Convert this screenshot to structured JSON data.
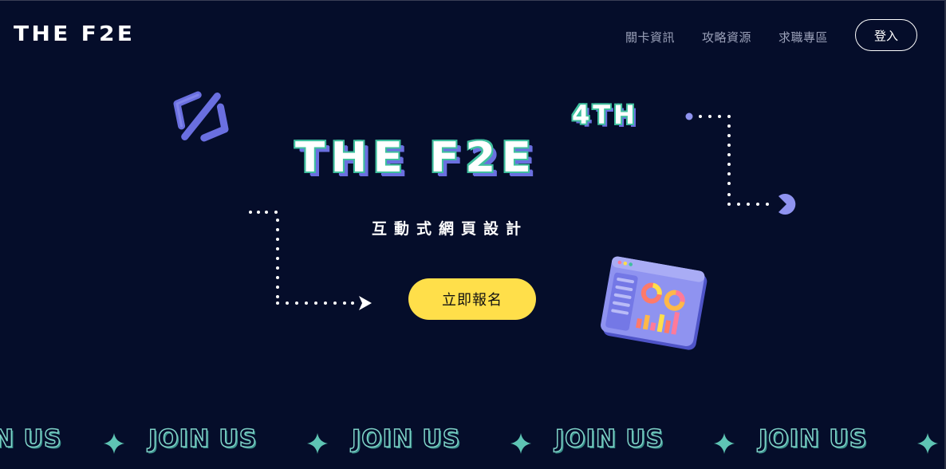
{
  "header": {
    "logo": "THE F2E",
    "nav": [
      "關卡資訊",
      "攻略資源",
      "求職專區"
    ],
    "login_label": "登入"
  },
  "hero": {
    "edition": "4TH",
    "title": "THE F2E",
    "subtitle": "互動式網頁設計",
    "cta_label": "立即報名"
  },
  "marquee": {
    "items": [
      "N US",
      "JOIN US",
      "JOIN US",
      "JOIN US",
      "JOIN US"
    ]
  },
  "colors": {
    "background": "#050D2A",
    "accent_yellow": "#FFDF4A",
    "accent_purple": "#6A6FE0",
    "accent_teal": "#3FBF9E",
    "nav_text": "#9AA0B8"
  },
  "icons": {
    "code": "code-icon",
    "dashboard": "dashboard-illustration",
    "star": "sparkle-icon",
    "arrow": "arrow-right-icon",
    "pacman": "pacman-icon"
  }
}
